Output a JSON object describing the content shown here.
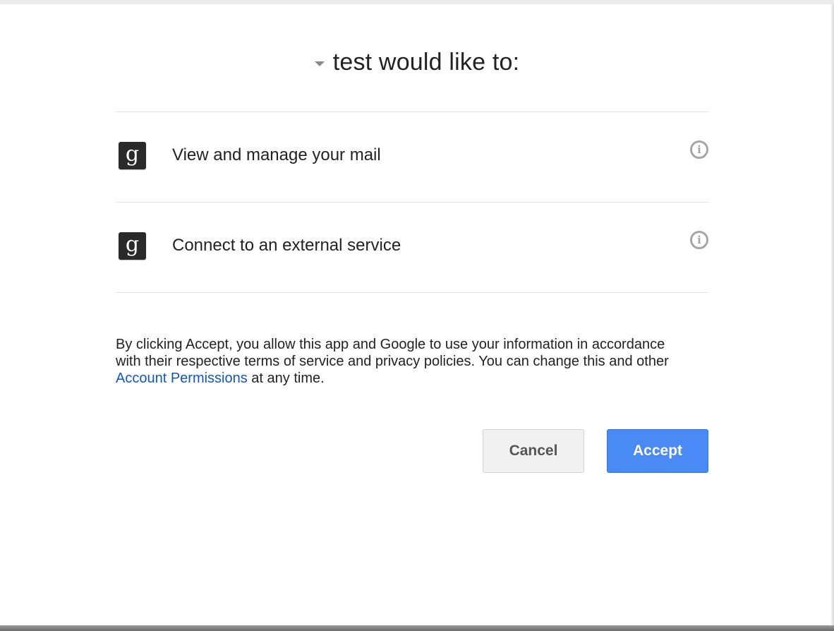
{
  "header": {
    "title": "test would like to:",
    "dropdown_icon": "caret-down-icon"
  },
  "permissions": [
    {
      "icon": "google-g-icon",
      "icon_glyph": "g",
      "label": "View and manage your mail",
      "info_icon": "info-icon",
      "info_glyph": "i"
    },
    {
      "icon": "google-g-icon",
      "icon_glyph": "g",
      "label": "Connect to an external service",
      "info_icon": "info-icon",
      "info_glyph": "i"
    }
  ],
  "consent": {
    "text_before": "By clicking Accept, you allow this app and Google to use your information in accordance with their respective terms of service and privacy policies. You can change this and other ",
    "link_text": "Account Permissions",
    "text_after": " at any time."
  },
  "buttons": {
    "cancel_label": "Cancel",
    "accept_label": "Accept"
  },
  "colors": {
    "accent": "#4a8af4",
    "link": "#1155cc"
  }
}
